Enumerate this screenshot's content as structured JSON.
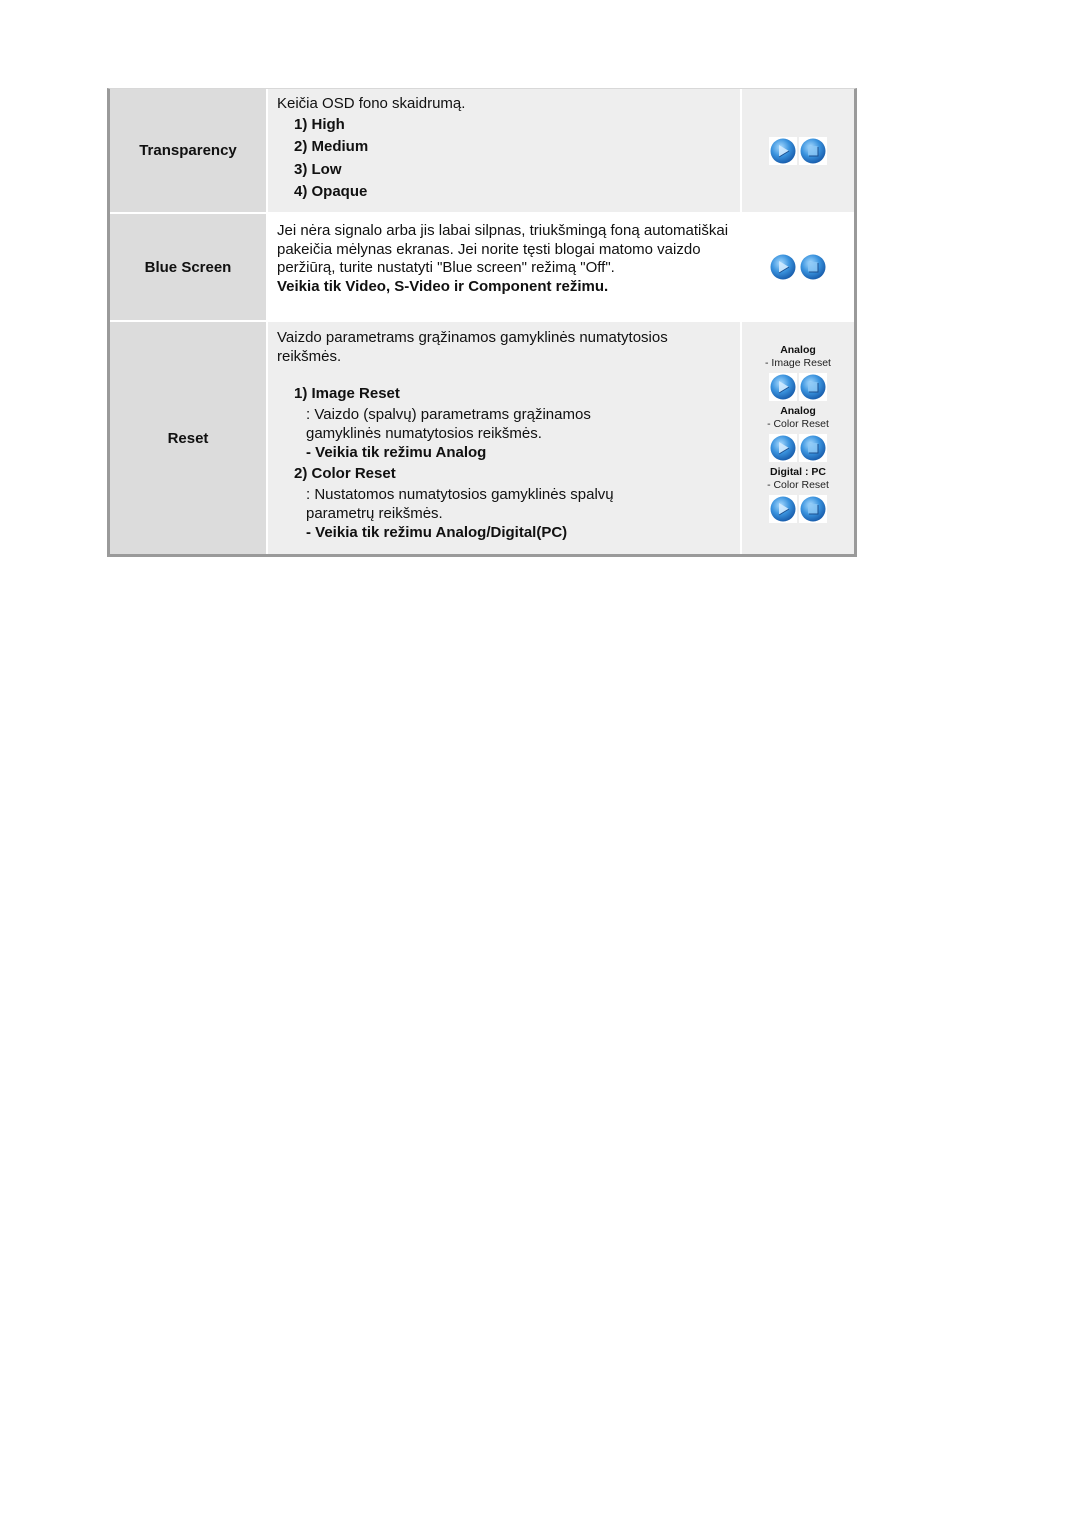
{
  "rows": [
    {
      "label": "Transparency",
      "description": "Keičia OSD fono skaidrumą.",
      "options": [
        "1) High",
        "2) Medium",
        "3) Low",
        "4) Opaque"
      ]
    },
    {
      "label": "Blue Screen",
      "description": "Jei nėra signalo arba jis labai silpnas, triukšmingą foną automatiškai pakeičia mėlynas ekranas. Jei norite tęsti blogai matomo vaizdo peržiūrą, turite nustatyti \"Blue screen\" režimą \"Off\".",
      "note": "Veikia tik Video, S-Video ir Component režimu."
    },
    {
      "label": "Reset",
      "description": "Vaizdo parametrams grąžinamos gamyklinės numatytosios reikšmės.",
      "items": [
        {
          "title": "1) Image Reset",
          "text": ": Vaizdo (spalvų) parametrams grąžinamos gamyklinės numatytosios reikšmės.",
          "note": "- Veikia tik režimu Analog"
        },
        {
          "title": "2) Color Reset",
          "text": ": Nustatomos numatytosios gamyklinės spalvų parametrų reikšmės.",
          "note": "- Veikia tik režimu Analog/Digital(PC)"
        }
      ],
      "icon_groups": [
        {
          "mode": "Analog",
          "caption": "- Image Reset"
        },
        {
          "mode": "Analog",
          "caption": "- Color Reset"
        },
        {
          "mode": "Digital : PC",
          "caption": "- Color Reset"
        }
      ]
    }
  ],
  "icons": {
    "play": "play-button-icon",
    "enter": "enter-button-icon",
    "color_primary": "#2a86d8",
    "color_light": "#8fcaf5"
  }
}
